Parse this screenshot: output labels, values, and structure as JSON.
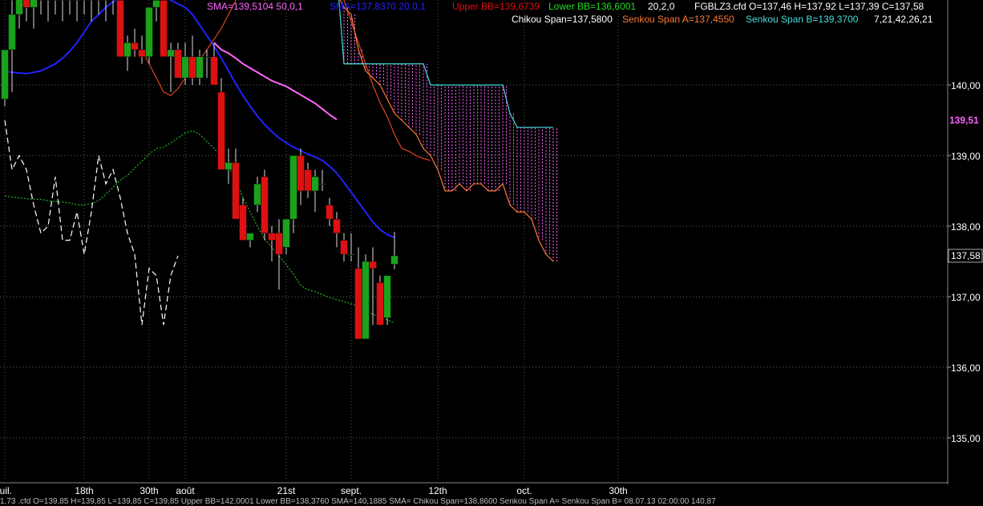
{
  "chart_data": {
    "type": "candlestick",
    "instrument": "FGBLZ3.cfd",
    "ohlc_header": {
      "symbol": "FGBLZ3.cfd",
      "open": "O=137,46",
      "high": "H=137,92",
      "low": "L=137,39",
      "close": "C=137,58"
    },
    "legend_row1": [
      {
        "text": "SMA=139,5104  50,0,1",
        "color": "#ff66ff"
      },
      {
        "text": "SMA=137,8370  20,0,1",
        "color": "#2222ff"
      },
      {
        "text": "Upper BB=139,6739",
        "color": "#dd1111"
      },
      {
        "text": "Lower BB=136,6001",
        "color": "#22dd22"
      },
      {
        "text": "20,2,0",
        "color": "#ffffff"
      },
      {
        "text": "FGBLZ3.cfd O=137,46 H=137,92 L=137,39 C=137,58",
        "color": "#ffffff"
      }
    ],
    "legend_row2": [
      {
        "text": "Chikou Span=137,5800",
        "color": "#ffffff"
      },
      {
        "text": "Senkou Span A=137,4550",
        "color": "#ff7733"
      },
      {
        "text": "Senkou Span B=139,3700",
        "color": "#44dddd"
      },
      {
        "text": "7,21,42,26,21",
        "color": "#ffffff"
      }
    ],
    "y_ticks": [
      "140,00",
      "139,00",
      "138,00",
      "137,00",
      "136,00",
      "135,00"
    ],
    "y_tick_values": [
      140,
      139,
      138,
      137,
      136,
      135
    ],
    "x_ticks": [
      {
        "label": "juil.",
        "bar": 0
      },
      {
        "label": "18th",
        "bar": 11
      },
      {
        "label": "30th",
        "bar": 20
      },
      {
        "label": "août",
        "bar": 25
      },
      {
        "label": "21st",
        "bar": 39
      },
      {
        "label": "sept.",
        "bar": 48
      },
      {
        "label": "12th",
        "bar": 60
      },
      {
        "label": "oct.",
        "bar": 72
      },
      {
        "label": "30th",
        "bar": 85
      }
    ],
    "price_marker_sma50": {
      "label": "139,51",
      "value": 139.51,
      "color": "#ff66ff"
    },
    "price_marker_last": {
      "label": "137,58",
      "value": 137.58
    },
    "ylim": [
      134.4,
      141.2
    ],
    "candles": [
      {
        "o": 139.8,
        "h": 140.5,
        "l": 139.7,
        "c": 140.5
      },
      {
        "o": 140.5,
        "h": 141.2,
        "l": 139.9,
        "c": 141.0
      },
      {
        "o": 141.0,
        "h": 141.4,
        "l": 140.8,
        "c": 141.3
      },
      {
        "o": 141.3,
        "h": 141.6,
        "l": 140.9,
        "c": 141.1
      },
      {
        "o": 141.1,
        "h": 141.5,
        "l": 140.8,
        "c": 141.3
      },
      {
        "o": 141.3,
        "h": 141.7,
        "l": 141.0,
        "c": 141.2
      },
      {
        "o": 141.2,
        "h": 141.5,
        "l": 140.9,
        "c": 141.3
      },
      {
        "o": 141.3,
        "h": 141.6,
        "l": 141.0,
        "c": 141.2
      },
      {
        "o": 141.2,
        "h": 141.5,
        "l": 140.9,
        "c": 141.3
      },
      {
        "o": 141.3,
        "h": 141.6,
        "l": 141.0,
        "c": 141.2
      },
      {
        "o": 141.2,
        "h": 141.5,
        "l": 140.9,
        "c": 141.3
      },
      {
        "o": 141.3,
        "h": 141.6,
        "l": 141.0,
        "c": 141.2
      },
      {
        "o": 141.2,
        "h": 141.5,
        "l": 140.9,
        "c": 141.3
      },
      {
        "o": 141.3,
        "h": 141.6,
        "l": 141.0,
        "c": 141.2
      },
      {
        "o": 141.2,
        "h": 141.5,
        "l": 140.9,
        "c": 141.3
      },
      {
        "o": 141.3,
        "h": 141.4,
        "l": 141.0,
        "c": 141.2
      },
      {
        "o": 141.2,
        "h": 141.3,
        "l": 140.9,
        "c": 140.4
      },
      {
        "o": 140.4,
        "h": 140.7,
        "l": 140.2,
        "c": 140.6
      },
      {
        "o": 140.6,
        "h": 140.8,
        "l": 140.4,
        "c": 140.5
      },
      {
        "o": 140.5,
        "h": 140.7,
        "l": 140.3,
        "c": 140.4
      },
      {
        "o": 140.4,
        "h": 141.0,
        "l": 140.3,
        "c": 141.1
      },
      {
        "o": 141.1,
        "h": 141.3,
        "l": 140.9,
        "c": 141.2
      },
      {
        "o": 141.2,
        "h": 141.3,
        "l": 140.9,
        "c": 140.4
      },
      {
        "o": 140.4,
        "h": 140.6,
        "l": 139.9,
        "c": 140.5
      },
      {
        "o": 140.5,
        "h": 140.6,
        "l": 140.3,
        "c": 140.1
      },
      {
        "o": 140.1,
        "h": 140.6,
        "l": 140.0,
        "c": 140.4
      },
      {
        "o": 140.4,
        "h": 140.7,
        "l": 140.0,
        "c": 140.1
      },
      {
        "o": 140.1,
        "h": 140.5,
        "l": 140.0,
        "c": 140.4
      },
      {
        "o": 140.4,
        "h": 140.5,
        "l": 140.1,
        "c": 140.4
      },
      {
        "o": 140.4,
        "h": 140.6,
        "l": 140.1,
        "c": 140.0
      },
      {
        "o": 139.9,
        "h": 140.1,
        "l": 138.8,
        "c": 138.8
      },
      {
        "o": 138.8,
        "h": 139.1,
        "l": 138.6,
        "c": 138.9
      },
      {
        "o": 138.9,
        "h": 139.1,
        "l": 138.1,
        "c": 138.1
      },
      {
        "o": 138.3,
        "h": 138.4,
        "l": 137.8,
        "c": 137.8
      },
      {
        "o": 137.8,
        "h": 137.9,
        "l": 137.7,
        "c": 137.9
      },
      {
        "o": 138.3,
        "h": 138.7,
        "l": 138.2,
        "c": 138.6
      },
      {
        "o": 138.7,
        "h": 138.8,
        "l": 137.8,
        "c": 137.9
      },
      {
        "o": 137.9,
        "h": 138.0,
        "l": 137.5,
        "c": 137.8
      },
      {
        "o": 137.9,
        "h": 138.1,
        "l": 137.1,
        "c": 137.6
      },
      {
        "o": 137.7,
        "h": 138.1,
        "l": 137.6,
        "c": 138.1
      },
      {
        "o": 138.1,
        "h": 139.0,
        "l": 137.9,
        "c": 139.0
      },
      {
        "o": 139.0,
        "h": 139.1,
        "l": 138.3,
        "c": 138.5
      },
      {
        "o": 138.8,
        "h": 138.9,
        "l": 138.4,
        "c": 138.5
      },
      {
        "o": 138.5,
        "h": 138.8,
        "l": 138.2,
        "c": 138.7
      },
      {
        "o": 138.6,
        "h": 138.8,
        "l": 138.5,
        "c": 138.6
      },
      {
        "o": 138.3,
        "h": 138.4,
        "l": 138.0,
        "c": 138.1
      },
      {
        "o": 138.1,
        "h": 138.2,
        "l": 137.7,
        "c": 137.9
      },
      {
        "o": 137.8,
        "h": 137.9,
        "l": 137.5,
        "c": 137.6
      },
      {
        "o": 137.6,
        "h": 137.9,
        "l": 137.5,
        "c": 137.6
      },
      {
        "o": 137.4,
        "h": 137.7,
        "l": 136.4,
        "c": 136.4
      },
      {
        "o": 136.4,
        "h": 137.6,
        "l": 136.4,
        "c": 137.5
      },
      {
        "o": 137.5,
        "h": 137.7,
        "l": 136.6,
        "c": 137.4
      },
      {
        "o": 137.2,
        "h": 137.3,
        "l": 136.6,
        "c": 136.6
      },
      {
        "o": 136.7,
        "h": 137.3,
        "l": 136.6,
        "c": 137.3
      },
      {
        "o": 137.46,
        "h": 137.92,
        "l": 137.39,
        "c": 137.58
      }
    ],
    "series": [
      {
        "name": "SMA 50,0,1",
        "color": "#ff66ff",
        "style": "solid",
        "bar0": 29,
        "values": [
          140.6,
          140.5,
          140.45,
          140.38,
          140.3,
          140.24,
          140.18,
          140.12,
          140.06,
          140.02,
          139.98,
          139.92,
          139.86,
          139.8,
          139.74,
          139.66,
          139.58,
          139.51
        ]
      },
      {
        "name": "SMA 20,0,1",
        "color": "#2222ff",
        "style": "solid",
        "bar0": 0,
        "values": [
          140.2,
          140.18,
          140.17,
          140.16,
          140.18,
          140.2,
          140.25,
          140.3,
          140.38,
          140.48,
          140.6,
          140.75,
          140.9,
          141.0,
          141.1,
          141.18,
          141.22,
          141.24,
          141.25,
          141.26,
          141.26,
          141.26,
          141.25,
          141.2,
          141.15,
          141.1,
          141.0,
          140.85,
          140.7,
          140.55,
          140.38,
          140.2,
          140.02,
          139.85,
          139.7,
          139.56,
          139.44,
          139.34,
          139.25,
          139.18,
          139.12,
          139.07,
          139.02,
          138.98,
          138.93,
          138.85,
          138.75,
          138.62,
          138.48,
          138.34,
          138.2,
          138.06,
          137.95,
          137.88,
          137.84
        ]
      },
      {
        "name": "Upper BB",
        "color": "#dd4422",
        "style": "solid",
        "bar0": 19,
        "values": [
          140.5,
          140.3,
          140.1,
          139.9,
          139.85,
          139.95,
          140.1,
          140.2,
          140.35,
          140.5,
          140.65,
          140.8,
          141.0,
          141.2,
          141.5,
          141.8,
          142.0,
          142.1,
          142.2,
          142.2,
          142.2,
          142.15,
          142.1,
          142.05,
          142.0,
          141.9,
          141.7,
          141.5,
          141.2,
          140.9,
          140.6,
          140.3,
          140.0,
          139.75,
          139.55,
          139.3,
          139.1,
          139.06,
          139.0,
          138.96,
          138.93
        ]
      },
      {
        "name": "Lower BB",
        "color": "#22bb22",
        "style": "dotted",
        "bar0": 0,
        "values": [
          138.43,
          138.41,
          138.4,
          138.39,
          138.38,
          138.38,
          138.36,
          138.35,
          138.34,
          138.33,
          138.3,
          138.3,
          138.32,
          138.36,
          138.45,
          138.55,
          138.65,
          138.72,
          138.82,
          138.92,
          139.02,
          139.1,
          139.12,
          139.18,
          139.25,
          139.32,
          139.35,
          139.3,
          139.2,
          139.1,
          139.0,
          138.85,
          138.65,
          138.4,
          138.2,
          138.0,
          137.82,
          137.7,
          137.58,
          137.45,
          137.32,
          137.16,
          137.1,
          137.07,
          137.03,
          136.99,
          136.96,
          136.93,
          136.9,
          136.86,
          136.8,
          136.75,
          136.71,
          136.67,
          136.63
        ]
      },
      {
        "name": "Chikou Span",
        "color": "#ffffff",
        "style": "dashed",
        "bar0": 0,
        "values": [
          139.5,
          138.8,
          139.0,
          138.8,
          138.3,
          137.9,
          138.0,
          138.7,
          137.8,
          137.8,
          138.2,
          137.6,
          138.2,
          139.0,
          138.6,
          138.8,
          138.4,
          137.9,
          137.6,
          136.6,
          137.4,
          137.3,
          136.6,
          137.3,
          137.58
        ]
      },
      {
        "name": "Senkou Span A",
        "color": "#ff7733",
        "style": "solid",
        "bar0": 36,
        "values": [
          141.2,
          141.3,
          141.4,
          141.5,
          141.6,
          141.7,
          141.6,
          141.5,
          141.4,
          141.4,
          141.3,
          141.1,
          141.0,
          140.5,
          140.2,
          140.1,
          140.0,
          139.8,
          139.6,
          139.5,
          139.4,
          139.3,
          139.1,
          139.0,
          138.8,
          138.5,
          138.5,
          138.6,
          138.5,
          138.6,
          138.6,
          138.5,
          138.5,
          138.6,
          138.3,
          138.2,
          138.2,
          138.1,
          137.8,
          137.6,
          137.5
        ]
      },
      {
        "name": "Senkou Span B",
        "color": "#44dddd",
        "style": "solid",
        "bar0": 36,
        "values": [
          141.6,
          141.6,
          141.6,
          141.6,
          141.6,
          141.6,
          141.6,
          141.6,
          141.6,
          141.6,
          141.6,
          140.3,
          140.3,
          140.3,
          140.3,
          140.3,
          140.3,
          140.3,
          140.3,
          140.3,
          140.3,
          140.3,
          140.3,
          140.0,
          140.0,
          140.0,
          140.0,
          140.0,
          140.0,
          140.0,
          140.0,
          140.0,
          140.0,
          140.0,
          139.6,
          139.4,
          139.4,
          139.4,
          139.4,
          139.4,
          139.4
        ]
      }
    ]
  },
  "status_line": "1,73 .cfd O=139,85 H=139,85 L=139,85 C=139,85  Upper BB=142,0001 Lower BB=138,3760 SMA=140,1885 SMA=   Chikou Span=138,8600 Senkou Span A=   Senkou Span B=   08.07.13 02:00:00 140,87"
}
